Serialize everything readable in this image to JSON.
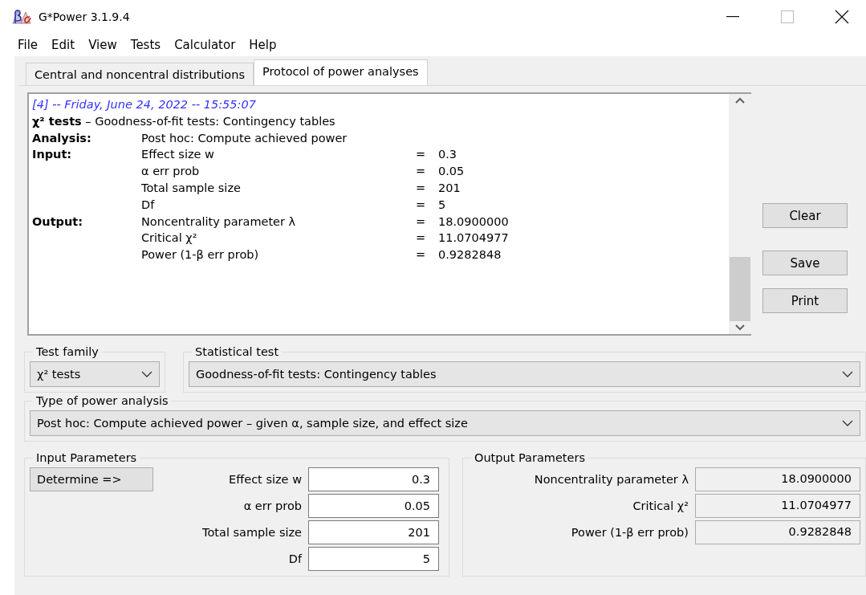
{
  "window": {
    "title": "G*Power 3.1.9.4"
  },
  "menu": [
    "File",
    "Edit",
    "View",
    "Tests",
    "Calculator",
    "Help"
  ],
  "tabs": [
    {
      "label": "Central and noncentral distributions",
      "selected": false
    },
    {
      "label": "Protocol of power analyses",
      "selected": true
    }
  ],
  "protocol": {
    "header": "[4] -- Friday, June 24, 2022 -- 15:55:07",
    "title": "**χ² tests** – Goodness-of-fit tests: Contingency tables",
    "rows": [
      {
        "section": "Analysis:",
        "name": "Post hoc: Compute achieved power"
      },
      {
        "section": "Input:",
        "name": "Effect size w",
        "equals": "=",
        "value": "0.3"
      },
      {
        "name": "α err prob",
        "equals": "=",
        "value": "0.05"
      },
      {
        "name": "Total sample size",
        "equals": "=",
        "value": "201"
      },
      {
        "name": "Df",
        "equals": "=",
        "value": "5"
      },
      {
        "section": "Output:",
        "name": "Noncentrality parameter λ",
        "equals": "=",
        "value": "18.0900000"
      },
      {
        "name": "Critical χ²",
        "equals": "=",
        "value": "11.0704977"
      },
      {
        "name": "Power (1-β err prob)",
        "equals": "=",
        "value": "0.9282848"
      }
    ]
  },
  "protocol_buttons": [
    "Clear",
    "Save",
    "Print"
  ],
  "test_family": {
    "label": "Test family",
    "value": "χ² tests"
  },
  "statistical_test": {
    "label": "Statistical test",
    "value": "Goodness-of-fit tests: Contingency tables"
  },
  "power_analysis": {
    "label": "Type of power analysis",
    "value": "Post hoc: Compute achieved power – given α, sample size, and effect size"
  },
  "input_parameters": {
    "label": "Input Parameters",
    "button": "Determine =>",
    "fields": [
      {
        "label": "Effect size w",
        "value": "0.3"
      },
      {
        "label": "α err prob",
        "value": "0.05"
      },
      {
        "label": "Total sample size",
        "value": "201"
      },
      {
        "label": "Df",
        "value": "5"
      }
    ]
  },
  "output_parameters": {
    "label": "Output Parameters",
    "fields": [
      {
        "label": "Noncentrality parameter λ",
        "value": "18.0900000"
      },
      {
        "label": "Critical χ²",
        "value": "11.0704977"
      },
      {
        "label": "Power (1-β err prob)",
        "value": "0.9282848"
      }
    ]
  }
}
